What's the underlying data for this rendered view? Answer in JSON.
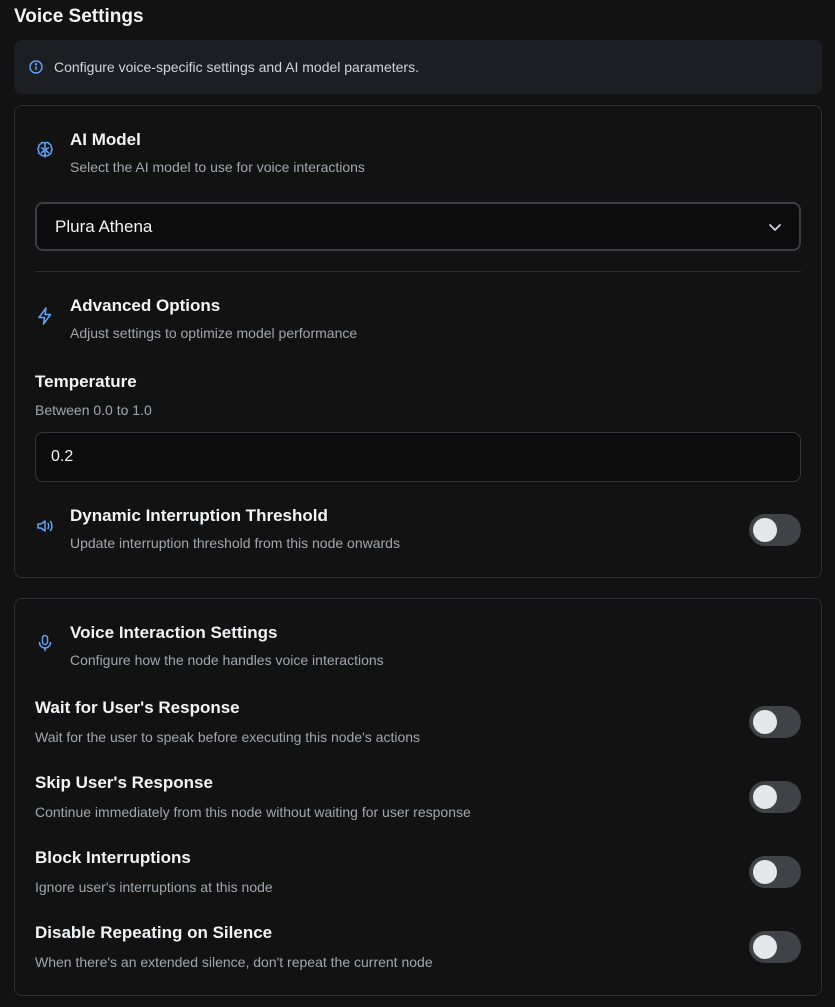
{
  "header": {
    "title": "Voice Settings"
  },
  "info": {
    "text": "Configure voice-specific settings and AI model parameters.",
    "icon": "info-circle-icon"
  },
  "ai_model": {
    "title": "AI Model",
    "description": "Select the AI model to use for voice interactions",
    "icon": "brain-icon",
    "selected": "Plura Athena"
  },
  "advanced": {
    "title": "Advanced Options",
    "description": "Adjust settings to optimize model performance",
    "icon": "lightning-icon",
    "temperature": {
      "label": "Temperature",
      "hint": "Between 0.0 to 1.0",
      "value": "0.2"
    },
    "dynamic_threshold": {
      "title": "Dynamic Interruption Threshold",
      "description": "Update interruption threshold from this node onwards",
      "icon": "speaker-icon",
      "enabled": false
    }
  },
  "voice": {
    "title": "Voice Interaction Settings",
    "description": "Configure how the node handles voice interactions",
    "icon": "microphone-icon",
    "options": [
      {
        "label": "Wait for User's Response",
        "description": "Wait for the user to speak before executing this node's actions",
        "enabled": false
      },
      {
        "label": "Skip User's Response",
        "description": "Continue immediately from this node without waiting for user response",
        "enabled": false
      },
      {
        "label": "Block Interruptions",
        "description": "Ignore user's interruptions at this node",
        "enabled": false
      },
      {
        "label": "Disable Repeating on Silence",
        "description": "When there's an extended silence, don't repeat the current node",
        "enabled": false
      }
    ]
  },
  "colors": {
    "accent": "#60a5fa",
    "background": "#121212",
    "card_border": "#2c2f33",
    "toggle_off": "#3f4246"
  }
}
